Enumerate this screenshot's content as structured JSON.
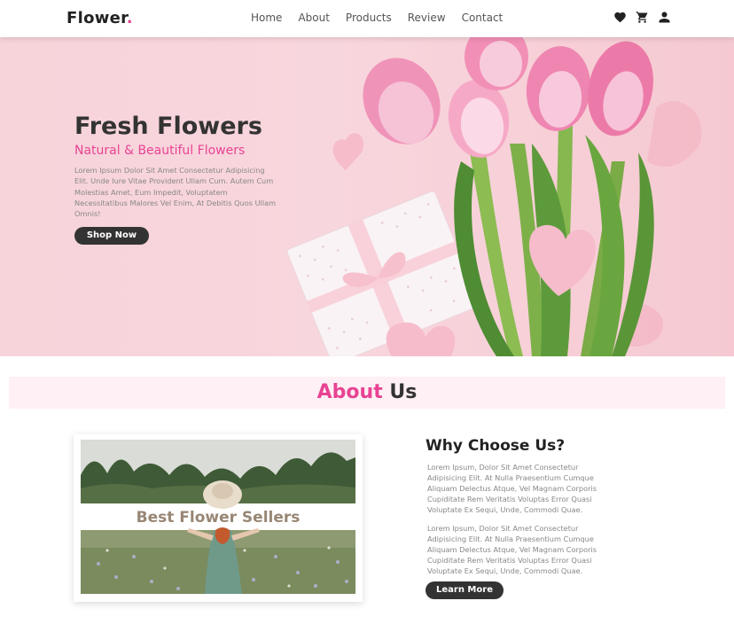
{
  "header": {
    "logo_text": "Flower",
    "logo_dot": ".",
    "nav": [
      "Home",
      "About",
      "Products",
      "Review",
      "Contact"
    ],
    "icons": [
      "heart-icon",
      "cart-icon",
      "user-icon"
    ]
  },
  "hero": {
    "title": "Fresh Flowers",
    "subtitle": "Natural & Beautiful Flowers",
    "text": "Lorem Ipsum Dolor Sit Amet Consectetur Adipisicing Elit. Unde Iure Vitae Provident Ullam Cum. Autem Cum Molestias Amet, Eum Impedit, Voluptatem Necessitatibus Malores Vel Enim, At Debitis Quos Ullam Omnis!",
    "button": "Shop Now"
  },
  "about": {
    "title_accent": "About",
    "title_rest": "Us",
    "video_caption": "Best Flower Sellers",
    "why_title": "Why Choose Us?",
    "paragraphs": [
      "Lorem Ipsum, Dolor Sit Amet Consectetur Adipisicing Elit. At Nulla Praesentium Cumque Aliquam Delectus Atque, Vel Magnam Corporis Cupiditate Rem Veritatis Voluptas Error Quasi Voluptate Ex Sequi, Unde, Commodi Quae.",
      "Lorem Ipsum, Dolor Sit Amet Consectetur Adipisicing Elit. At Nulla Praesentium Cumque Aliquam Delectus Atque, Vel Magnam Corporis Cupiditate Rem Veritatis Voluptas Error Quasi Voluptate Ex Sequi, Unde, Commodi Quae."
    ],
    "button": "Learn More"
  },
  "colors": {
    "accent": "#e84393",
    "dark": "#333333",
    "hero_bg": "#f7d3da",
    "about_band": "#fff0f6"
  }
}
